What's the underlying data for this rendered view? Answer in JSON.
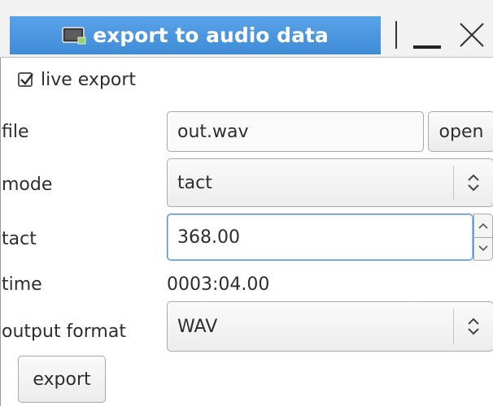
{
  "window": {
    "title": "export to audio data",
    "icon": "window-icon",
    "controls": [
      "minimize-icon",
      "close-icon"
    ]
  },
  "form": {
    "live_export": {
      "label": "live export",
      "checked": true
    },
    "file": {
      "label": "file",
      "value": "out.wav",
      "open_label": "open"
    },
    "mode": {
      "label": "mode",
      "value": "tact"
    },
    "tact": {
      "label": "tact",
      "value": "368.00"
    },
    "time": {
      "label": "time",
      "value": "0003:04.00"
    },
    "output_format": {
      "label": "output format",
      "value": "WAV"
    },
    "export_label": "export"
  },
  "colors": {
    "title_tab": "#4a95de",
    "focus_border": "#4a90d9",
    "text": "#2e2e2e"
  }
}
